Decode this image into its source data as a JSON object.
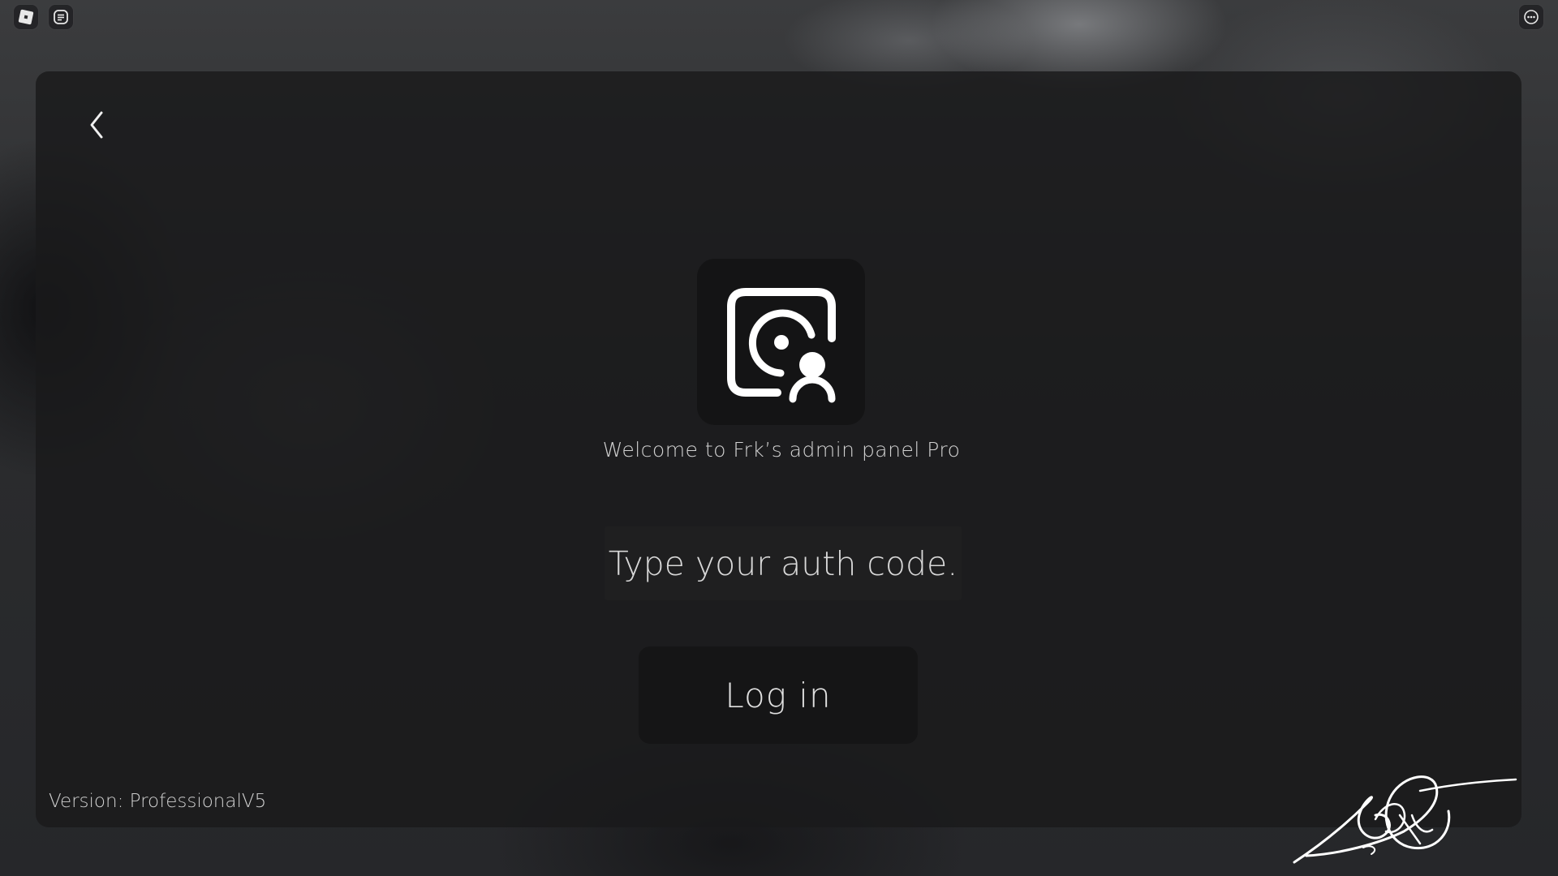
{
  "topbar": {
    "roblox_icon": "roblox-logo-icon",
    "chat_icon": "chat-icon",
    "more_icon": "more-icon"
  },
  "panel": {
    "back_icon": "chevron-left-icon",
    "logo_icon": "admin-user-scan-icon",
    "welcome_text": "Welcome to Frk’s admin panel Pro",
    "auth_input": {
      "value": "",
      "placeholder": "Type your auth code."
    },
    "login_label": "Log in",
    "version_text": "Version: ProfessionalV5"
  },
  "colors": {
    "panel_bg": "#1a1a1b",
    "logo_bg": "#141415",
    "button_bg": "#151516",
    "text": "#d8d8d8"
  }
}
